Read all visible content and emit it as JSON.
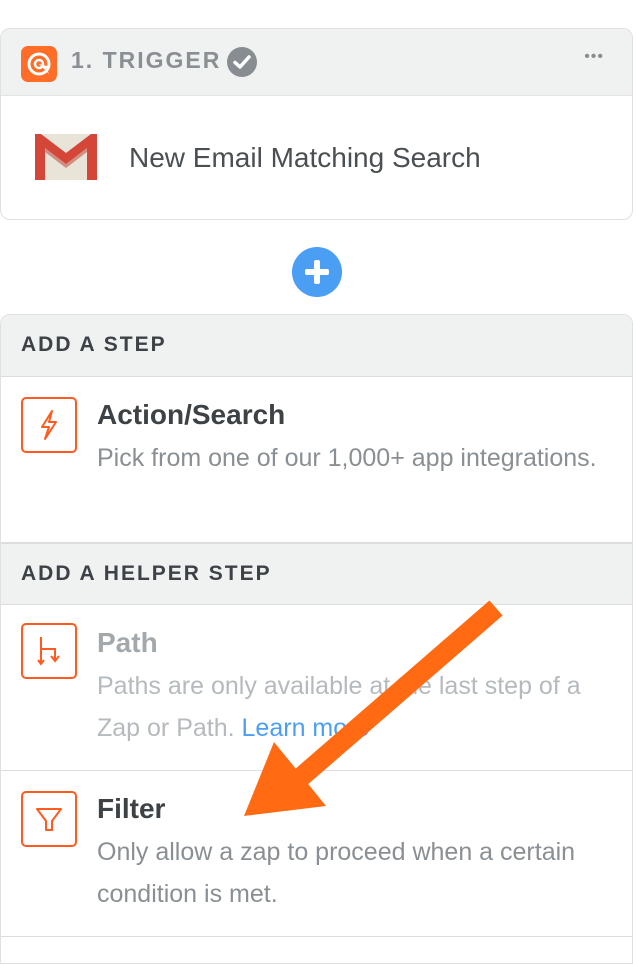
{
  "trigger": {
    "title": "1. TRIGGER",
    "app_name": "New Email Matching Search",
    "status_icon": "check-circle-icon",
    "menu_icon": "more-dots-icon",
    "more_label": "•••",
    "colors": {
      "brand": "#ff6d29",
      "header_bg": "#f0f1f1"
    }
  },
  "add_button": {
    "icon": "plus-icon",
    "color": "#4a9ff5"
  },
  "add_step": {
    "header": "ADD A STEP",
    "options": [
      {
        "title": "Action/Search",
        "description": "Pick from one of our 1,000+ app integrations.",
        "icon": "lightning-icon"
      }
    ]
  },
  "helper_step": {
    "header": "ADD A HELPER STEP",
    "options": [
      {
        "title": "Path",
        "description": "Paths are only available at the last step of a Zap or Path.",
        "link": "Learn more",
        "icon": "path-icon",
        "disabled": true
      },
      {
        "title": "Filter",
        "description": "Only allow a zap to proceed when a certain condition is met.",
        "icon": "filter-icon"
      }
    ]
  },
  "annotation": {
    "type": "arrow",
    "color": "#ff6a13"
  }
}
